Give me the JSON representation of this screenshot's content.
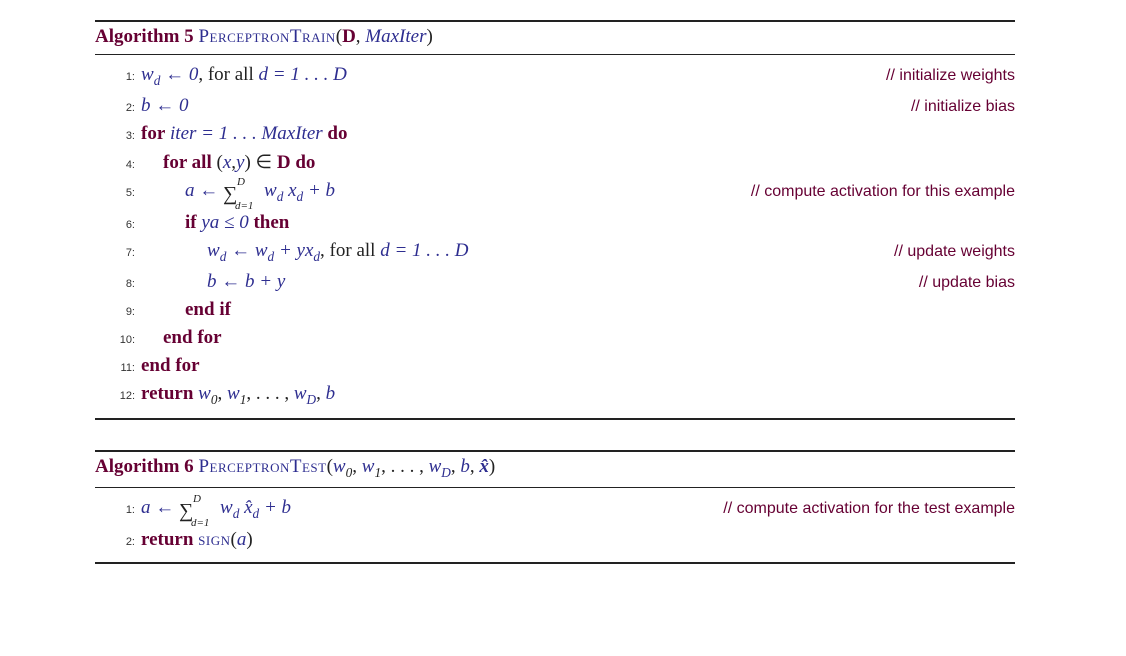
{
  "algo5": {
    "header": {
      "word": "Algorithm 5",
      "name": "PerceptronTrain",
      "args_open": "(",
      "arg1": "D",
      "args_sep": ", ",
      "arg2": "MaxIter",
      "args_close": ")"
    },
    "lines": [
      {
        "n": "1:",
        "code": {
          "pre": "",
          "a": "w",
          "sub": "d",
          "b": " ← 0",
          "tail": ", for all  ",
          "c": "d",
          "d": " = 1 . . . ",
          "e": "D"
        },
        "comment": "// initialize weights"
      },
      {
        "n": "2:",
        "code": {
          "a": "b",
          "b": " ← 0"
        },
        "comment": "// initialize bias"
      },
      {
        "n": "3:",
        "for": "for",
        "mid": " iter = 1 . . . MaxIter ",
        "do": "do"
      },
      {
        "n": "4:",
        "forall": "for all",
        "open": " (",
        "x": "x",
        "c1": ",",
        "y": "y",
        "close": ") ∈ ",
        "D": "D",
        "do": " do"
      },
      {
        "n": "5:",
        "a": "a",
        "arrow": " ← ",
        "sumUp": "D",
        "sumDn": "d=1",
        "w": " w",
        "wd": "d",
        "x": " x",
        "xd": "d",
        "plus": " + ",
        "b": "b",
        "comment": "// compute activation for this example"
      },
      {
        "n": "6:",
        "if": "if",
        "cond": " ya ≤ 0 ",
        "then": "then"
      },
      {
        "n": "7:",
        "w1": "w",
        "w1s": "d",
        "arr": " ← ",
        "w2": "w",
        "w2s": "d",
        "plus": " + ",
        "y": "y",
        "x": "x",
        "xs": "d",
        "tail": ", for all  ",
        "d": "d",
        "eq": " = 1 . . . ",
        "D": "D",
        "comment": "// update weights"
      },
      {
        "n": "8:",
        "b1": "b",
        "arr": " ← ",
        "b2": "b",
        "plus": " + ",
        "y": "y",
        "comment": "// update bias"
      },
      {
        "n": "9:",
        "endif": "end if"
      },
      {
        "n": "10:",
        "endfor": "end for"
      },
      {
        "n": "11:",
        "endfor": "end for"
      },
      {
        "n": "12:",
        "return": "return",
        "sp": "  ",
        "w0": "w",
        "s0": "0",
        "c1": ", ",
        "w1": "w",
        "s1": "1",
        "c2": ", . . . , ",
        "wD": "w",
        "sD": "D",
        "c3": ", ",
        "b": "b"
      }
    ]
  },
  "algo6": {
    "header": {
      "word": "Algorithm 6",
      "name": "PerceptronTest",
      "args_open": "(",
      "w0": "w",
      "s0": "0",
      "c1": ", ",
      "w1": "w",
      "s1": "1",
      "c2": ", . . . , ",
      "wD": "w",
      "sD": "D",
      "c3": ", ",
      "b": "b",
      "c4": ", ",
      "xh": "x̂",
      "args_close": ")"
    },
    "lines": [
      {
        "n": "1:",
        "a": "a",
        "arrow": " ← ",
        "sumUp": "D",
        "sumDn": "d=1",
        "w": " w",
        "wd": "d",
        "x": " x̂",
        "xd": "d",
        "plus": " + ",
        "b": "b",
        "comment": "// compute activation for the test example"
      },
      {
        "n": "2:",
        "return": "return",
        "sp": "  ",
        "sign": "sign",
        "open": "(",
        "a": "a",
        "close": ")"
      }
    ]
  }
}
